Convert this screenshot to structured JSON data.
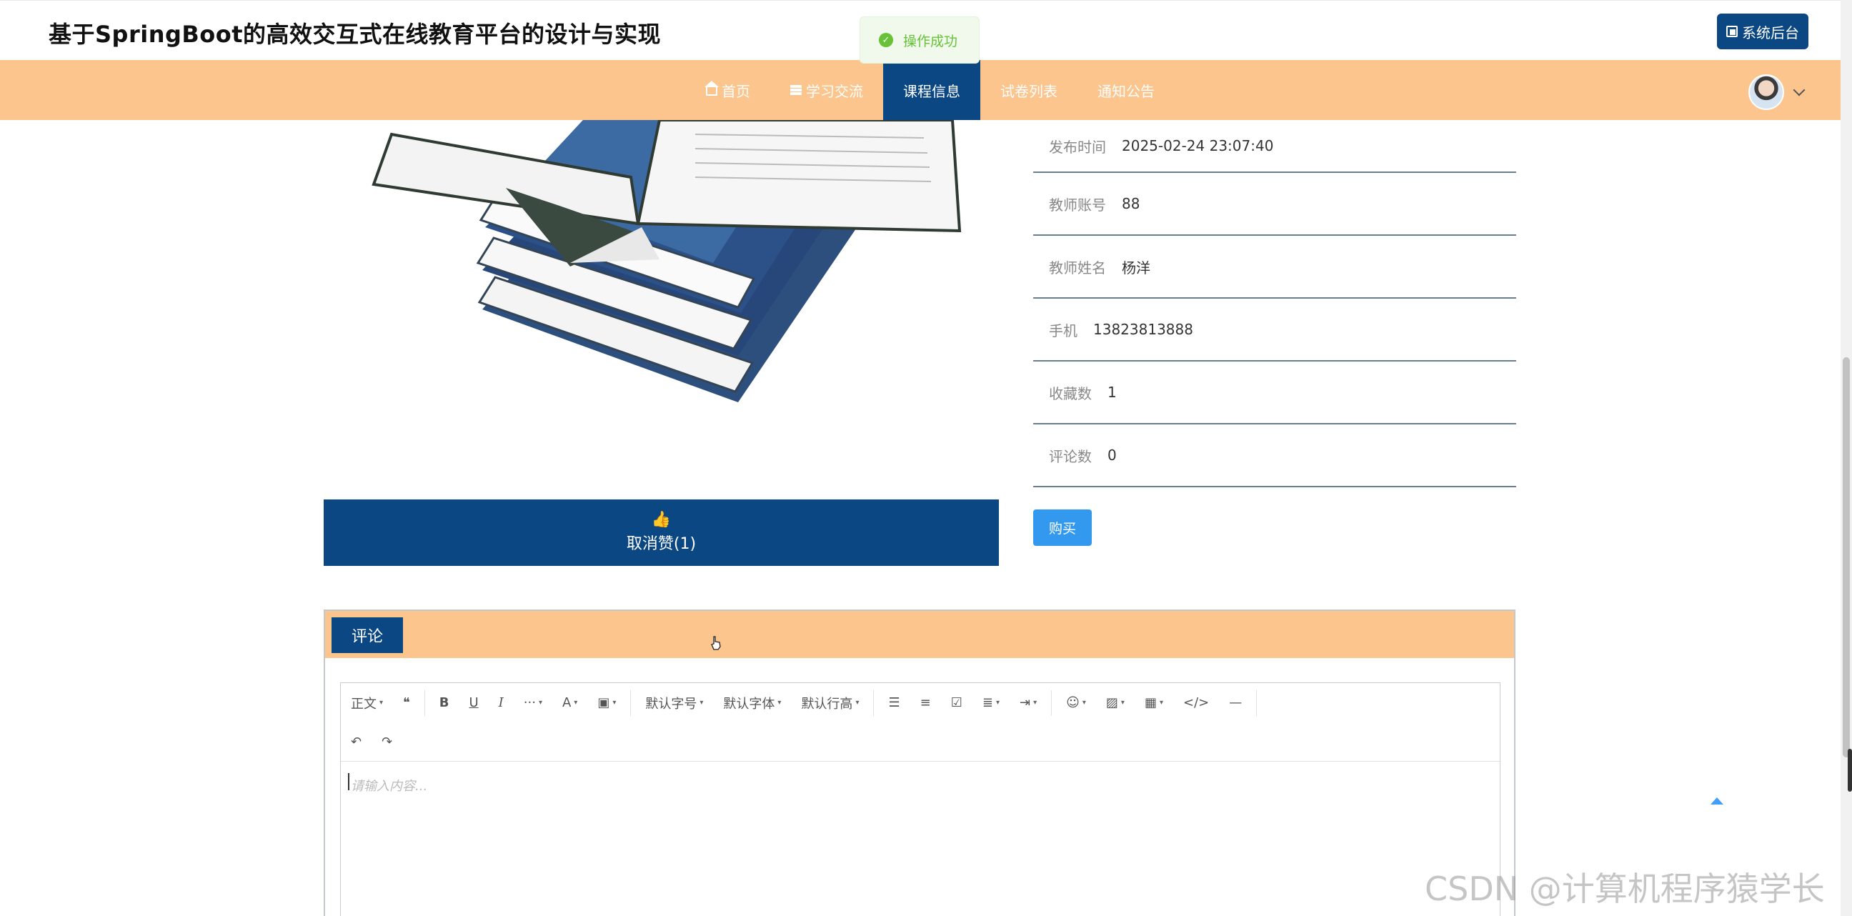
{
  "header": {
    "site_title": "基于SpringBoot的高效交互式在线教育平台的设计与实现",
    "admin_button": "系统后台"
  },
  "toast": {
    "message": "操作成功"
  },
  "nav": {
    "items": [
      {
        "label": "首页",
        "icon": "home-icon"
      },
      {
        "label": "学习交流",
        "icon": "list-icon"
      },
      {
        "label": "课程信息",
        "active": true
      },
      {
        "label": "试卷列表"
      },
      {
        "label": "通知公告"
      }
    ],
    "active_color": "#0b4783",
    "bar_color": "#fcc58d"
  },
  "course": {
    "fields": [
      {
        "label": "发布时间",
        "value": "2025-02-24 23:07:40"
      },
      {
        "label": "教师账号",
        "value": "88"
      },
      {
        "label": "教师姓名",
        "value": "杨洋"
      },
      {
        "label": "手机",
        "value": "13823813888"
      },
      {
        "label": "收藏数",
        "value": "1"
      },
      {
        "label": "评论数",
        "value": "0"
      }
    ],
    "like_button": "取消赞(1)",
    "buy_button": "购买"
  },
  "comment": {
    "tab_label": "评论",
    "editor": {
      "toolbar_row1": [
        {
          "label": "正文",
          "caret": true,
          "name": "heading-select"
        },
        {
          "label": "❝",
          "name": "quote-icon"
        },
        {
          "label": "B",
          "name": "bold-icon",
          "style": "b"
        },
        {
          "label": "U",
          "name": "underline-icon",
          "style": "u"
        },
        {
          "label": "I",
          "name": "italic-icon",
          "style": "i"
        },
        {
          "label": "···",
          "caret": true,
          "name": "more-icon"
        },
        {
          "label": "A",
          "caret": true,
          "name": "font-color-icon"
        },
        {
          "label": "▣",
          "caret": true,
          "name": "bg-color-icon"
        },
        {
          "label": "默认字号",
          "caret": true,
          "name": "font-size-select"
        },
        {
          "label": "默认字体",
          "caret": true,
          "name": "font-family-select"
        },
        {
          "label": "默认行高",
          "caret": true,
          "name": "line-height-select"
        },
        {
          "label": "☰",
          "name": "bullet-list-icon"
        },
        {
          "label": "≡",
          "name": "numbered-list-icon"
        },
        {
          "label": "☑",
          "name": "todo-icon"
        },
        {
          "label": "≣",
          "caret": true,
          "name": "align-icon"
        },
        {
          "label": "⇥",
          "caret": true,
          "name": "indent-icon"
        },
        {
          "label": "☺",
          "caret": true,
          "name": "emoji-icon"
        },
        {
          "label": "▨",
          "caret": true,
          "name": "image-icon"
        },
        {
          "label": "▦",
          "caret": true,
          "name": "table-icon"
        },
        {
          "label": "</>",
          "name": "code-icon"
        },
        {
          "label": "—",
          "name": "divider-icon"
        }
      ],
      "toolbar_row2": [
        {
          "label": "↶",
          "name": "undo-icon"
        },
        {
          "label": "↷",
          "name": "redo-icon"
        }
      ],
      "placeholder": "请输入内容..."
    }
  },
  "watermark": "CSDN @计算机程序猿学长"
}
